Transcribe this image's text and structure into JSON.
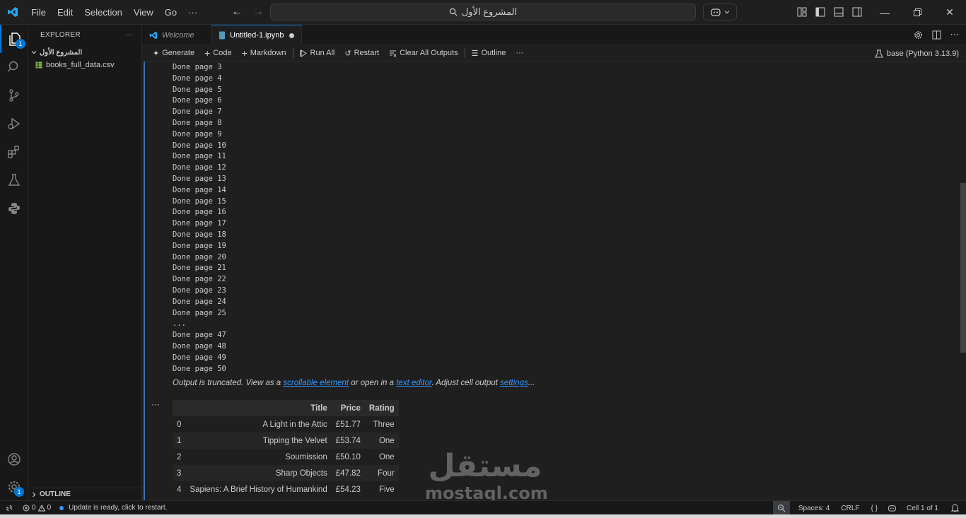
{
  "titlebar": {
    "menu": [
      "File",
      "Edit",
      "Selection",
      "View",
      "Go",
      "···"
    ],
    "search_text": "المشروع الأول"
  },
  "sidebar": {
    "header": "EXPLORER",
    "header_more": "···",
    "folder": "المشروع الأول",
    "files": [
      "books_full_data.csv"
    ],
    "outline_label": "OUTLINE",
    "explorer_badge": "1",
    "settings_badge": "1"
  },
  "tabs": [
    {
      "label": "Welcome"
    },
    {
      "label": "Untitled-1.ipynb"
    }
  ],
  "toolbar": {
    "generate": "Generate",
    "code": "Code",
    "markdown": "Markdown",
    "run_all": "Run All",
    "restart": "Restart",
    "clear_outputs": "Clear All Outputs",
    "outline": "Outline",
    "more": "···",
    "kernel": "base (Python 3.13.9)"
  },
  "output": {
    "lines": [
      "Done page 3",
      "Done page 4",
      "Done page 5",
      "Done page 6",
      "Done page 7",
      "Done page 8",
      "Done page 9",
      "Done page 10",
      "Done page 11",
      "Done page 12",
      "Done page 13",
      "Done page 14",
      "Done page 15",
      "Done page 16",
      "Done page 17",
      "Done page 18",
      "Done page 19",
      "Done page 20",
      "Done page 21",
      "Done page 22",
      "Done page 23",
      "Done page 24",
      "Done page 25",
      "...",
      "Done page 47",
      "Done page 48",
      "Done page 49",
      "Done page 50"
    ],
    "truncated_prefix": "Output is truncated. View as a ",
    "truncated_link1": "scrollable element",
    "truncated_mid1": " or open in a ",
    "truncated_link2": "text editor",
    "truncated_mid2": ". Adjust cell output ",
    "truncated_link3": "settings",
    "truncated_suffix": "...",
    "cell_menu": "···"
  },
  "dataframe": {
    "columns": [
      "",
      "Title",
      "Price",
      "Rating"
    ],
    "rows": [
      [
        "0",
        "A Light in the Attic",
        "£51.77",
        "Three"
      ],
      [
        "1",
        "Tipping the Velvet",
        "£53.74",
        "One"
      ],
      [
        "2",
        "Soumission",
        "£50.10",
        "One"
      ],
      [
        "3",
        "Sharp Objects",
        "£47.82",
        "Four"
      ],
      [
        "4",
        "Sapiens: A Brief History of Humankind",
        "£54.23",
        "Five"
      ]
    ]
  },
  "watermark": {
    "arabic": "مستقل",
    "latin": "mostaql.com"
  },
  "statusbar": {
    "errors": "0",
    "warnings": "0",
    "update_msg": "Update is ready, click to restart.",
    "spaces": "Spaces: 4",
    "eol": "CRLF",
    "braces": "{ }",
    "cell": "Cell 1 of 1"
  },
  "colors": {
    "accent": "#0078d4",
    "link": "#3794ff",
    "background": "#1f1f1f",
    "sidebar": "#181818"
  }
}
